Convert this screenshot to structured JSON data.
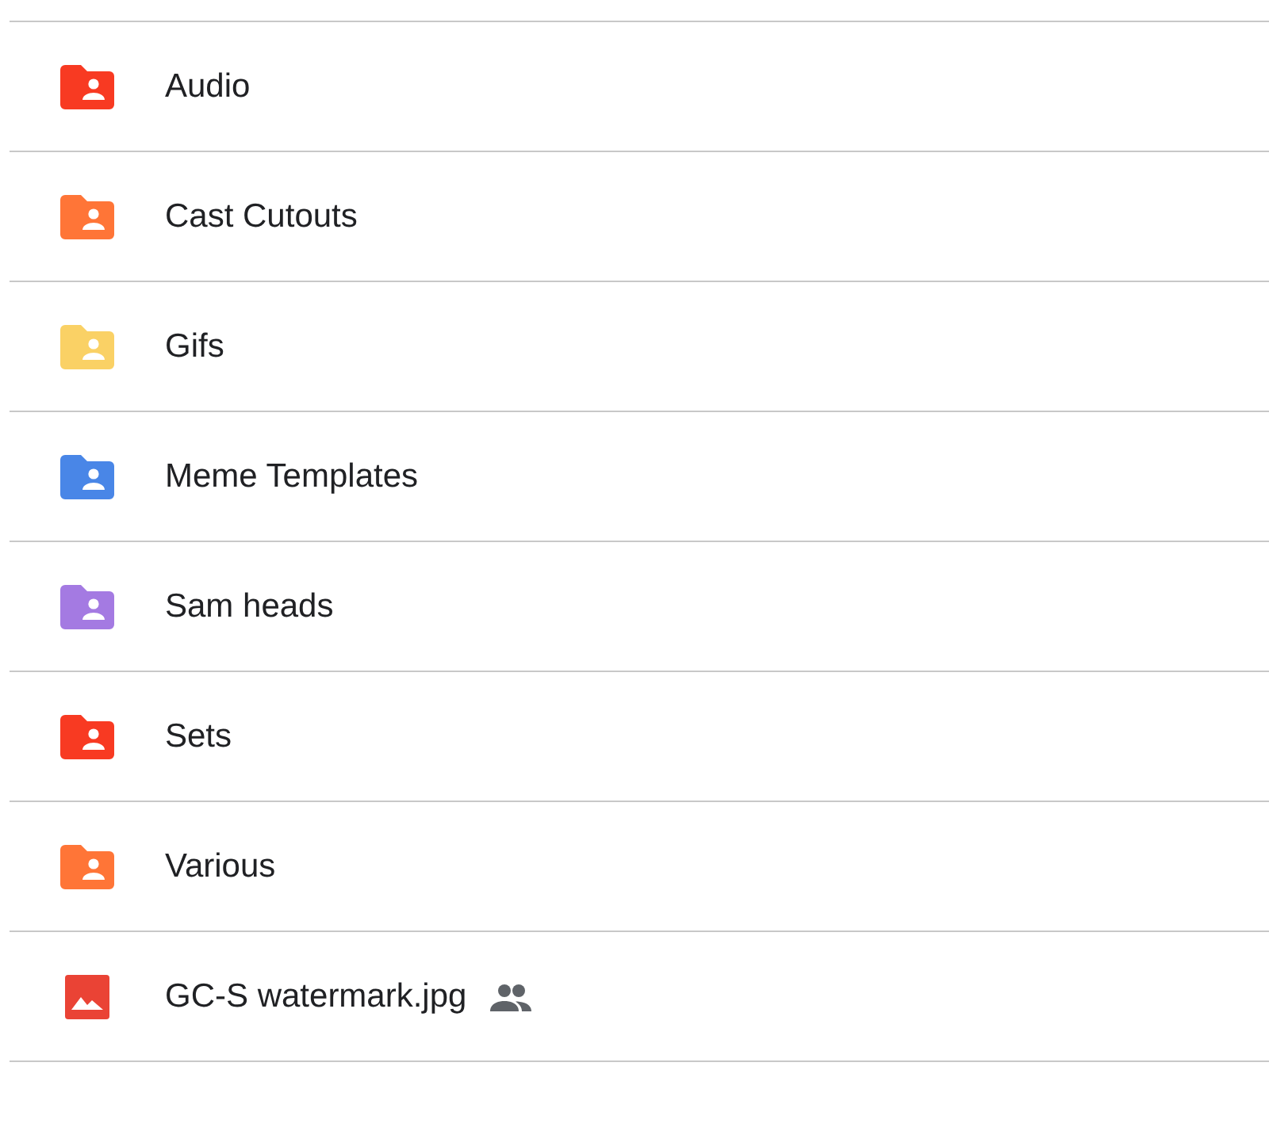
{
  "items": [
    {
      "kind": "folder",
      "name": "Audio",
      "color": "#f83a22",
      "shared": false
    },
    {
      "kind": "folder",
      "name": "Cast Cutouts",
      "color": "#ff7537",
      "shared": false
    },
    {
      "kind": "folder",
      "name": "Gifs",
      "color": "#fad165",
      "shared": false
    },
    {
      "kind": "folder",
      "name": "Meme Templates",
      "color": "#4986e7",
      "shared": false
    },
    {
      "kind": "folder",
      "name": "Sam heads",
      "color": "#a47ae2",
      "shared": false
    },
    {
      "kind": "folder",
      "name": "Sets",
      "color": "#f83a22",
      "shared": false
    },
    {
      "kind": "folder",
      "name": "Various",
      "color": "#ff7537",
      "shared": false
    },
    {
      "kind": "image",
      "name": "GC-S watermark.jpg",
      "shared": true
    }
  ]
}
